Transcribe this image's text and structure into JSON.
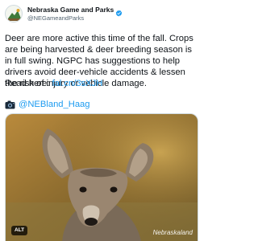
{
  "account": {
    "display_name": "Nebraska Game and Parks",
    "handle": "@NEGameandParks",
    "verified": true,
    "accent_color": "#1d9bf0"
  },
  "tweet": {
    "body_lines": [
      "Deer are more active this time of the fall. Crops are being harvested & deer breeding season is in full swing. NGPC has suggestions to help drivers avoid deer-vehicle accidents & lessen the risk of injury or vehicle damage."
    ],
    "read_here_label": "Read here:",
    "read_here_link": "fal.cn/3sXJH",
    "photo_credit": "@NEBland_Haag"
  },
  "media": {
    "watermark": "Nebraskaland",
    "alt_label": "ALT"
  },
  "icons": {
    "verified": "verified-badge-icon",
    "camera": "camera-icon",
    "avatar": "agency-seal-avatar"
  }
}
